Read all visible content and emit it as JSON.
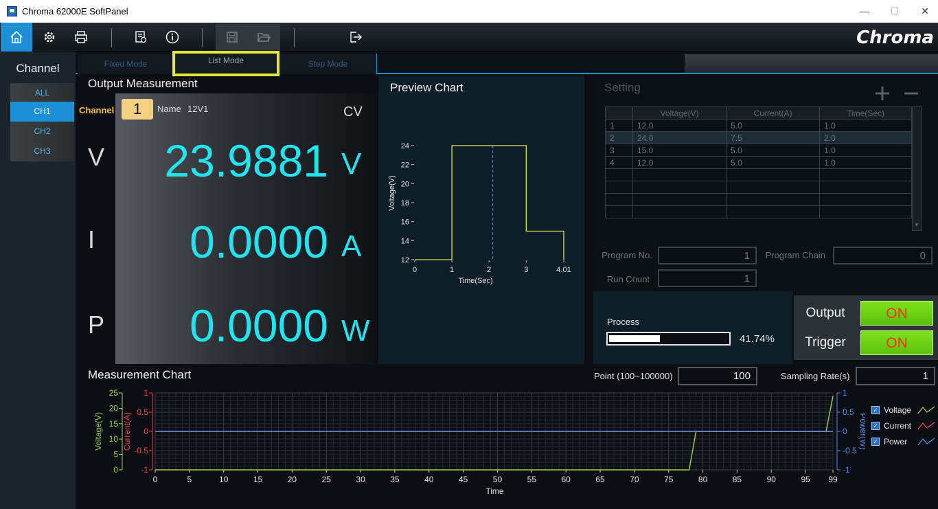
{
  "window": {
    "title": "Chroma 62000E SoftPanel",
    "minimize": "—",
    "maximize": "☐",
    "close": "✕"
  },
  "toolbar": {
    "buttons": [
      "home-icon",
      "settings-icon",
      "print-icon",
      "report-icon",
      "info-icon",
      "save-icon",
      "open-folder-icon",
      "exit-icon"
    ],
    "logo": "Chroma"
  },
  "sidebar": {
    "title": "Channel",
    "items": [
      "ALL",
      "CH1",
      "CH2",
      "CH3"
    ],
    "active": "CH1"
  },
  "modes": {
    "tabs": [
      "Fixed Mode",
      "List Mode",
      "Step Mode"
    ],
    "active": "List Mode"
  },
  "output_measurement": {
    "title": "Output Measurement",
    "channel_label": "Channel",
    "channel_number": "1",
    "name_label": "Name",
    "name_value": "12V1",
    "mode": "CV",
    "rows": [
      {
        "label": "V",
        "value": "23.9881",
        "unit": "V"
      },
      {
        "label": "I",
        "value": "0.0000",
        "unit": "A"
      },
      {
        "label": "P",
        "value": "0.0000",
        "unit": "W"
      }
    ]
  },
  "preview_chart": {
    "title": "Preview Chart",
    "chart_data": {
      "type": "line",
      "xlabel": "Time(Sec)",
      "ylabel": "Voltage(V)",
      "x_ticks": [
        "0",
        "1",
        "2",
        "3",
        "4.01"
      ],
      "y_ticks": [
        "12",
        "14",
        "16",
        "18",
        "20",
        "22",
        "24"
      ],
      "xlim": [
        0,
        4.01
      ],
      "ylim": [
        12,
        24
      ],
      "x": [
        0,
        1,
        1,
        3,
        3,
        4.01,
        4.01
      ],
      "y": [
        12,
        12,
        24,
        24,
        15,
        15,
        12
      ],
      "cursor_x": 2.1,
      "line_color": "#e8e85a",
      "cursor_color": "#4f8fd6"
    }
  },
  "setting": {
    "title": "Setting",
    "add_icon": "plus-icon",
    "remove_icon": "minus-icon",
    "columns": [
      "",
      "Voltage(V)",
      "Current(A)",
      "Time(Sec)"
    ],
    "rows": [
      [
        "1",
        "12.0",
        "5.0",
        "1.0"
      ],
      [
        "2",
        "24.0",
        "7.5",
        "2.0"
      ],
      [
        "3",
        "15.0",
        "5.0",
        "1.0"
      ],
      [
        "4",
        "12.0",
        "5.0",
        "1.0"
      ],
      [
        "",
        "",
        "",
        ""
      ],
      [
        "",
        "",
        "",
        ""
      ],
      [
        "",
        "",
        "",
        ""
      ],
      [
        "",
        "",
        "",
        ""
      ]
    ],
    "selected_row": 1,
    "program_no_label": "Program No.",
    "program_no": "1",
    "program_chain_label": "Program Chain",
    "program_chain": "0",
    "run_count_label": "Run Count",
    "run_count": "1"
  },
  "process": {
    "label": "Process",
    "percent_text": "41.74%",
    "fraction": 0.4174
  },
  "controls": {
    "output_label": "Output",
    "output_value": "ON",
    "trigger_label": "Trigger",
    "trigger_value": "ON"
  },
  "measurement_chart": {
    "title": "Measurement Chart",
    "point_label": "Point (100~100000)",
    "point_value": "100",
    "sampling_label": "Sampling Rate(s)",
    "sampling_value": "1",
    "legend": [
      {
        "name": "Voltage",
        "color": "#9ed34a"
      },
      {
        "name": "Current",
        "color": "#e8454f"
      },
      {
        "name": "Power",
        "color": "#4f8fe6"
      }
    ],
    "chart_data": {
      "type": "line",
      "xlabel": "Time",
      "xlim": [
        0,
        99
      ],
      "x_ticks": [
        "0",
        "5",
        "10",
        "15",
        "20",
        "25",
        "30",
        "35",
        "40",
        "45",
        "50",
        "55",
        "60",
        "65",
        "70",
        "75",
        "80",
        "85",
        "90",
        "95",
        "99"
      ],
      "y_axes": [
        {
          "label": "Voltage(V)",
          "ticks": [
            "0",
            "5",
            "10",
            "15",
            "20",
            "25"
          ],
          "ylim": [
            0,
            25
          ],
          "color": "#9ed34a"
        },
        {
          "label": "Current(A)",
          "ticks": [
            "-1",
            "-0.5",
            "0",
            "0.5",
            "1"
          ],
          "ylim": [
            -1,
            1
          ],
          "color": "#e8454f"
        },
        {
          "label": "Power(W)",
          "ticks": [
            "-1",
            "-0.5",
            "0",
            "0.5",
            "1"
          ],
          "ylim": [
            -1,
            1
          ],
          "color": "#4f8fe6"
        }
      ],
      "series": [
        {
          "name": "Voltage",
          "axis": 0,
          "x": [
            0,
            78,
            79,
            98,
            99
          ],
          "y": [
            0,
            0,
            12.5,
            12.5,
            24
          ]
        },
        {
          "name": "Current",
          "axis": 1,
          "x": [
            0,
            99
          ],
          "y": [
            0,
            0
          ]
        },
        {
          "name": "Power",
          "axis": 2,
          "x": [
            0,
            99
          ],
          "y": [
            0,
            0
          ]
        }
      ],
      "grid": true
    }
  }
}
